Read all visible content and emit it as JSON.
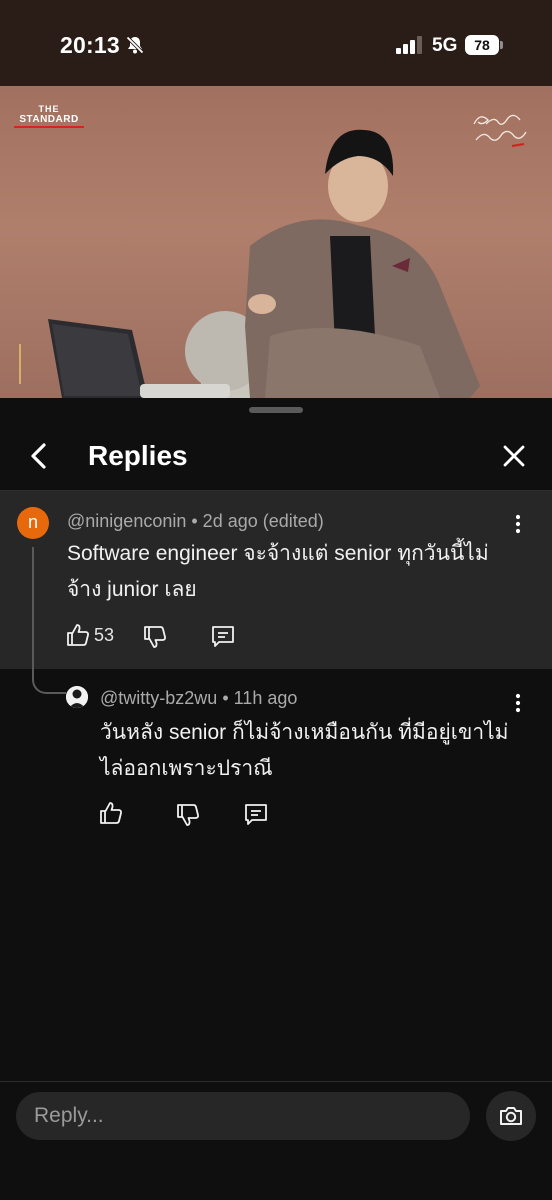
{
  "status": {
    "time": "20:13",
    "network": "5G",
    "battery": "78"
  },
  "video": {
    "logo_line1": "THE",
    "logo_line2": "STANDARD"
  },
  "panel": {
    "title": "Replies"
  },
  "parent_comment": {
    "handle": "@ninigenconin",
    "meta": "• 2d ago (edited)",
    "avatar_letter": "n",
    "avatar_color": "#e8690b",
    "text_line1": "Software engineer จะจ้างแต่ senior ทุกวันนี้ไม่",
    "text_line2": "จ้าง junior เลย",
    "likes": "53"
  },
  "reply_comment": {
    "handle": "@twitty-bz2wu",
    "meta": "• 11h ago",
    "text_line1": "วันหลัง senior ก็ไม่จ้างเหมือนกัน ที่มีอยู่เขาไม่",
    "text_line2": "ไล่ออกเพราะปราณี"
  },
  "reply_box": {
    "placeholder": "Reply..."
  },
  "icons": [
    "bell-off-icon",
    "signal-icon",
    "battery-icon",
    "back-arrow-icon",
    "close-icon",
    "more-vert-icon",
    "thumb-up-icon",
    "thumb-down-icon",
    "comment-icon",
    "camera-icon"
  ],
  "colors": {
    "sheet_bg": "#0f0f0f",
    "highlight_bg": "#272727",
    "video_bg": "#a2705f"
  }
}
